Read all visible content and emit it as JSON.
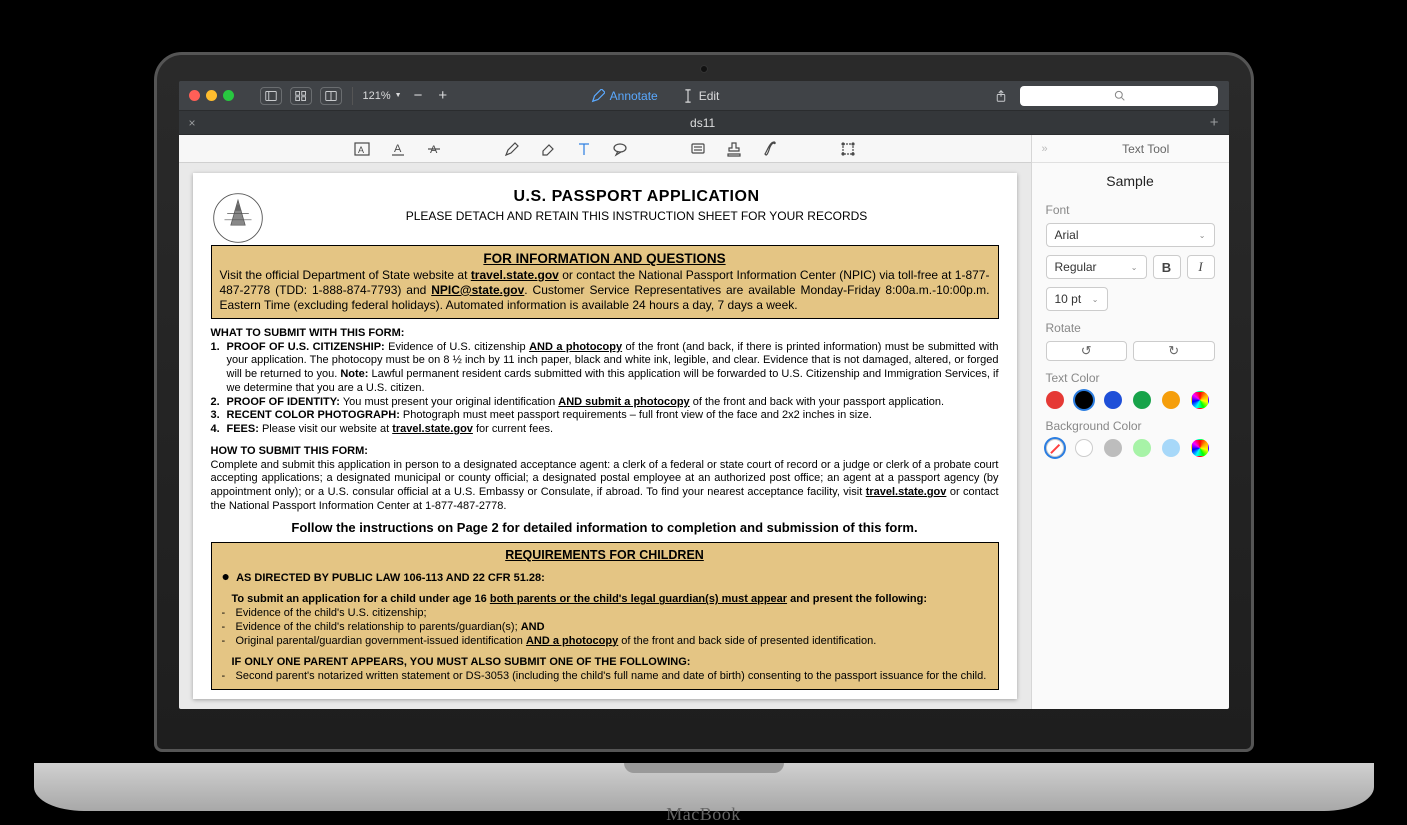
{
  "device_label": "MacBook",
  "toolbar": {
    "zoom": "121%",
    "annotate_label": "Annotate",
    "edit_label": "Edit"
  },
  "tab": {
    "title": "ds11"
  },
  "sidepanel": {
    "title": "Text Tool",
    "sample": "Sample",
    "font_label": "Font",
    "font_family": "Arial",
    "font_style": "Regular",
    "font_size": "10 pt",
    "bold": "B",
    "italic": "I",
    "rotate_label": "Rotate",
    "text_color_label": "Text Color",
    "bg_color_label": "Background Color",
    "text_colors": [
      "#e53935",
      "#000000",
      "#1e4fd8",
      "#17a34a",
      "#f59e0b"
    ],
    "bg_colors_plain": [
      "#ffffff",
      "#bdbdbd",
      "#a7f3a7",
      "#a7d8f9"
    ]
  },
  "doc": {
    "title": "U.S. PASSPORT APPLICATION",
    "subtitle": "PLEASE DETACH AND RETAIN THIS INSTRUCTION SHEET FOR YOUR RECORDS",
    "info_heading": "FOR INFORMATION AND QUESTIONS",
    "info_p1a": "Visit the official Department of State website at ",
    "info_link1": "travel.state.gov",
    "info_p1b": " or contact the National Passport Information Center (NPIC) via toll-free at 1-877-487-2778 (TDD: 1-888-874-7793) and ",
    "info_link2": "NPIC@state.gov",
    "info_p1c": ".  Customer Service Representatives are available Monday-Friday 8:00a.m.-10:00p.m. Eastern Time (excluding federal holidays). Automated information is available 24 hours a day, 7 days a week.",
    "what_heading": "WHAT TO SUBMIT WITH THIS FORM:",
    "li1_lead": "PROOF OF U.S. CITIZENSHIP:",
    "li1_a": " Evidence of U.S. citizenship ",
    "li1_u": "AND a photocopy",
    "li1_b": " of the front (and back, if there is printed information) must be submitted with your application. The photocopy must be on 8 ½ inch by 11 inch paper, black and white ink, legible, and clear. Evidence that is not damaged, altered, or forged will be returned to you. ",
    "li1_note": "Note:",
    "li1_c": " Lawful permanent resident cards submitted with this application will be forwarded to U.S. Citizenship and Immigration Services, if we determine that you are a U.S. citizen.",
    "li2_lead": "PROOF OF IDENTITY:",
    "li2_a": " You must present your original identification ",
    "li2_u": "AND submit a photocopy",
    "li2_b": " of the front and back with your passport application.",
    "li3_lead": "RECENT COLOR PHOTOGRAPH:",
    "li3_a": " Photograph must meet passport requirements – full front view of the face and 2x2 inches in size.",
    "li4_lead": "FEES:",
    "li4_a": " Please visit our website at ",
    "li4_link": "travel.state.gov",
    "li4_b": " for current fees.",
    "how_heading": "HOW TO SUBMIT THIS FORM:",
    "how_body_a": "Complete and submit this application in person to a designated acceptance agent:  a clerk of a federal or state court of record or a judge or clerk of a probate court accepting applications; a designated municipal or county official; a designated postal employee at an authorized post office; an agent at a passport agency (by appointment only); or a U.S. consular official at a U.S. Embassy or Consulate, if abroad.  To find your nearest acceptance facility, visit ",
    "how_link": "travel.state.gov",
    "how_body_b": " or contact the National Passport Information Center at 1-877-487-2778.",
    "follow": "Follow the instructions on Page 2 for detailed information to completion and submission of this form.",
    "req_heading": "REQUIREMENTS FOR CHILDREN",
    "req_directed": "AS DIRECTED BY PUBLIC LAW 106-113 AND 22 CFR 51.28:",
    "req_sub_a": "To submit an application for a child under age 16 ",
    "req_sub_u": "both parents or the child's legal guardian(s) must appear",
    "req_sub_b": " and present the following:",
    "req_b1": "Evidence of the child's U.S. citizenship;",
    "req_b2a": "Evidence of the child's relationship to parents/guardian(s); ",
    "req_b2b": "AND",
    "req_b3a": "Original parental/guardian government-issued identification ",
    "req_b3u": "AND a photocopy",
    "req_b3b": " of the front and back side of presented identification.",
    "req_one": "IF ONLY ONE PARENT APPEARS, YOU MUST ALSO SUBMIT ONE OF THE FOLLOWING:",
    "req_one_b1": "Second parent's notarized written statement or DS-3053 (including the child's full name and date of birth) consenting to the passport issuance for the child."
  }
}
